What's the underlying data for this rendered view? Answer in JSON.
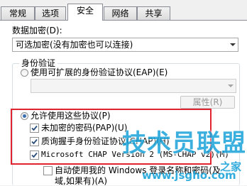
{
  "tabs": [
    "常规",
    "选项",
    "安全",
    "网络",
    "共享"
  ],
  "active_tab": "安全",
  "encryption": {
    "label": "数据加密(D):",
    "value": "可选加密(没有加密也可以连接)"
  },
  "auth": {
    "group_title": "身份验证",
    "eap_radio_label": "使用可扩展的身份验证协议(EAP)(E)",
    "eap_combo_value": "",
    "properties_button": "属性(R)",
    "allow_radio_label": "允许使用这些协议(P)",
    "protocols": [
      {
        "label": "未加密的密码(PAP)(U)",
        "checked": true
      },
      {
        "label": "质询握手身份验证协议(CHAP)(H)",
        "checked": true
      },
      {
        "label": "Microsoft CHAP Version 2 (MS-CHAP v2)(M)",
        "checked": true
      }
    ],
    "auto_logon_line1": "自动使用我的 Windows 登录名称和密码(及",
    "auto_logon_line2": "域,如果有)(A)"
  },
  "watermark": {
    "logo_text": "技术员联盟",
    "site": "www.jsgho.com",
    "suffix": "之家"
  },
  "colors": {
    "highlight": "#e0232f",
    "watermark": "#1aa3d9",
    "radio_dot": "#3c6fb0"
  }
}
